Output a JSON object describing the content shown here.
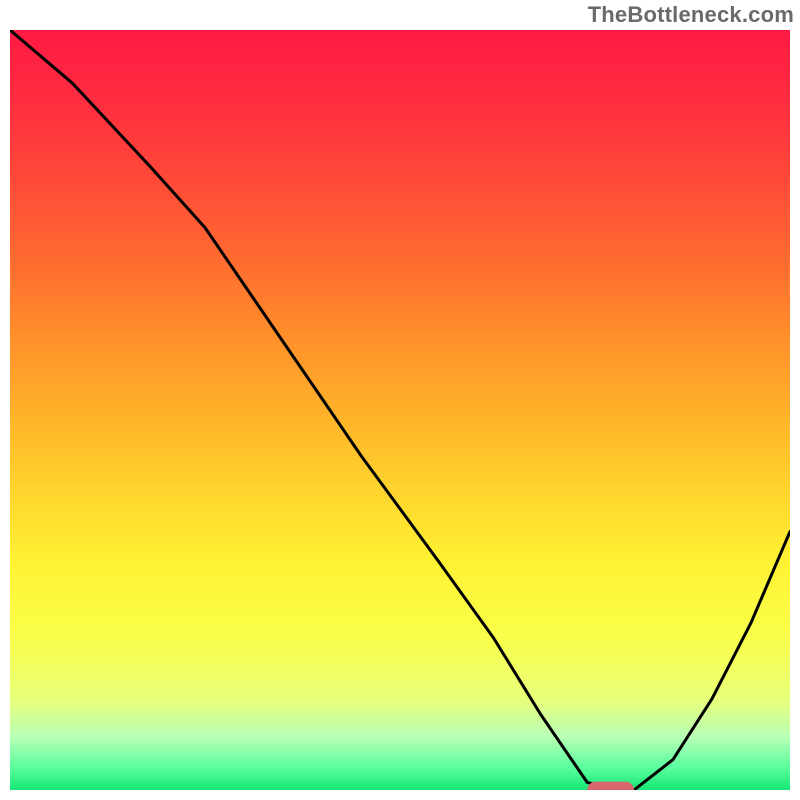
{
  "watermark": "TheBottleneck.com",
  "chart_data": {
    "type": "line",
    "title": "",
    "xlabel": "",
    "ylabel": "",
    "xlim": [
      0,
      100
    ],
    "ylim": [
      0,
      100
    ],
    "grid": false,
    "legend": false,
    "x": [
      0,
      8,
      18,
      25,
      35,
      45,
      55,
      62,
      68,
      72,
      74,
      78,
      80,
      85,
      90,
      95,
      100
    ],
    "values": [
      100,
      93,
      82,
      74,
      59,
      44,
      30,
      20,
      10,
      4,
      1,
      0,
      0,
      4,
      12,
      22,
      34
    ],
    "gradient_stops": [
      {
        "pct": 0.0,
        "color": "#ff1a43"
      },
      {
        "pct": 0.1,
        "color": "#ff2f3f"
      },
      {
        "pct": 0.2,
        "color": "#ff4a38"
      },
      {
        "pct": 0.3,
        "color": "#ff6a30"
      },
      {
        "pct": 0.4,
        "color": "#ff8e2b"
      },
      {
        "pct": 0.5,
        "color": "#ffb029"
      },
      {
        "pct": 0.6,
        "color": "#ffd22c"
      },
      {
        "pct": 0.7,
        "color": "#fff233"
      },
      {
        "pct": 0.8,
        "color": "#f8ff4a"
      },
      {
        "pct": 0.88,
        "color": "#e8ff7a"
      },
      {
        "pct": 0.93,
        "color": "#b8ffb5"
      },
      {
        "pct": 0.97,
        "color": "#5aff9e"
      },
      {
        "pct": 1.0,
        "color": "#17e676"
      }
    ],
    "marker": {
      "x": 77,
      "y": 0,
      "w": 6,
      "h": 2.2,
      "color": "#d9666b"
    },
    "curve_color": "#000000",
    "curve_stroke_px": 3
  }
}
